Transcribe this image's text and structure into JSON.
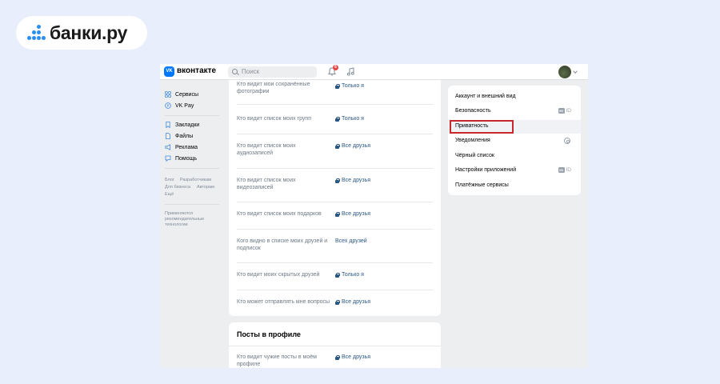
{
  "brand": {
    "logo_text": "банки.ру"
  },
  "header": {
    "site_name": "вконтакте",
    "logo_letters": "VK",
    "search_placeholder": "Поиск",
    "notification_count": "6"
  },
  "nav": {
    "items": [
      "Сервисы",
      "VK Pay",
      "Закладки",
      "Файлы",
      "Реклама",
      "Помощь"
    ],
    "footer_links": [
      "Блог",
      "Разработчикам",
      "Для бизнеса",
      "Авторам",
      "Ещё"
    ],
    "footer_note": "Применяются рекомендательные технологии"
  },
  "privacy": {
    "rows": [
      {
        "question": "Кто видит мои сохранённые фотографии",
        "answer": "Только я",
        "locked": true
      },
      {
        "question": "Кто видит список моих групп",
        "answer": "Только я",
        "locked": true
      },
      {
        "question": "Кто видит список моих аудиозаписей",
        "answer": "Все друзья",
        "locked": true
      },
      {
        "question": "Кто видит список моих видеозаписей",
        "answer": "Все друзья",
        "locked": true
      },
      {
        "question": "Кто видит список моих подарков",
        "answer": "Все друзья",
        "locked": true
      },
      {
        "question": "Кого видно в списке моих друзей и подписок",
        "answer": "Всех друзей",
        "locked": false
      },
      {
        "question": "Кто видит моих скрытых друзей",
        "answer": "Только я",
        "locked": true
      },
      {
        "question": "Кто может отправлять мне вопросы",
        "answer": "Все друзья",
        "locked": true
      }
    ],
    "posts_section": {
      "title": "Посты в профиле",
      "rows": [
        {
          "question": "Кто видит чужие посты в моём профиле",
          "answer": "Все друзья",
          "locked": true
        }
      ]
    }
  },
  "settings_menu": {
    "items": [
      {
        "label": "Аккаунт и внешний вид"
      },
      {
        "label": "Безопасность",
        "badge": "ID"
      },
      {
        "label": "Приватность",
        "active": true
      },
      {
        "label": "Уведомления"
      },
      {
        "label": "Чёрный список"
      },
      {
        "label": "Настройки приложений",
        "badge": "ID"
      },
      {
        "label": "Платёжные сервисы"
      }
    ],
    "id_badge_letters": "VK"
  }
}
